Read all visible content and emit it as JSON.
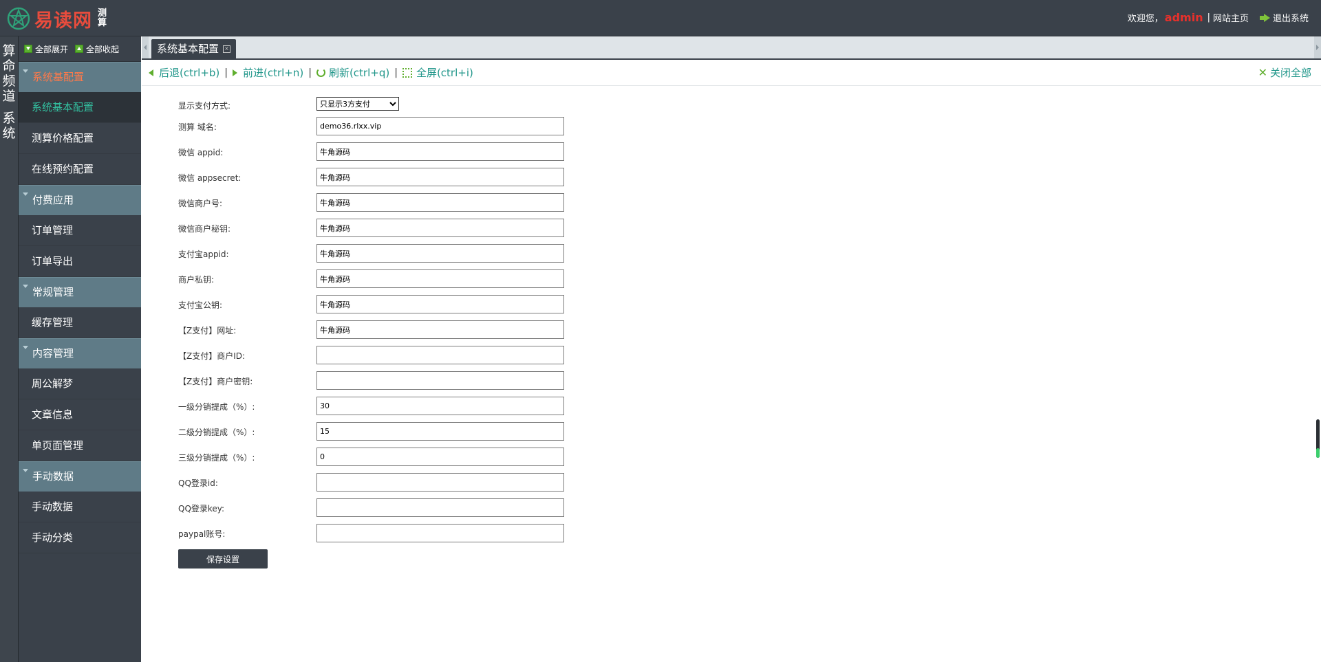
{
  "header": {
    "logo_text": "易读网",
    "logo_sub": "测算",
    "welcome": "欢迎您，",
    "username": "admin",
    "site_home": "网站主页",
    "logout": "退出系统",
    "separator": "|"
  },
  "channels": [
    {
      "label": "算命频道"
    },
    {
      "label": "系统"
    }
  ],
  "sidebar": {
    "expand_all": "全部展开",
    "collapse_all": "全部收起",
    "groups": [
      {
        "title": "系统基配置",
        "items": [
          "系统基本配置",
          "测算价格配置",
          "在线预约配置"
        ]
      },
      {
        "title": "付费应用",
        "items": [
          "订单管理",
          "订单导出"
        ]
      },
      {
        "title": "常规管理",
        "items": [
          "缓存管理"
        ]
      },
      {
        "title": "内容管理",
        "items": [
          "周公解梦",
          "文章信息",
          "单页面管理"
        ]
      },
      {
        "title": "手动数据",
        "items": [
          "手动数据",
          "手动分类"
        ]
      }
    ]
  },
  "tabs": [
    {
      "label": "系统基本配置",
      "close": "×"
    }
  ],
  "toolbar": {
    "back": "后退(ctrl+b)",
    "forward": "前进(ctrl+n)",
    "refresh": "刷新(ctrl+q)",
    "fullscreen": "全屏(ctrl+i)",
    "close_all": "关闭全部",
    "sep": "|"
  },
  "form": {
    "pay_mode": {
      "label": "显示支付方式:",
      "selected": "只显示3方支付"
    },
    "fields": [
      {
        "label": "测算 域名:",
        "value": "demo36.rlxx.vip"
      },
      {
        "label": "微信 appid:",
        "value": "牛角源码"
      },
      {
        "label": "微信 appsecret:",
        "value": "牛角源码"
      },
      {
        "label": "微信商户号:",
        "value": "牛角源码"
      },
      {
        "label": "微信商户秘钥:",
        "value": "牛角源码"
      },
      {
        "label": "支付宝appid:",
        "value": "牛角源码"
      },
      {
        "label": "商户私钥:",
        "value": "牛角源码"
      },
      {
        "label": "支付宝公钥:",
        "value": "牛角源码"
      },
      {
        "label": "【Z支付】网址:",
        "value": "牛角源码"
      },
      {
        "label": "【Z支付】商户ID:",
        "value": ""
      },
      {
        "label": "【Z支付】商户密钥:",
        "value": ""
      },
      {
        "label": "一级分销提成（%）:",
        "value": "30"
      },
      {
        "label": "二级分销提成（%）:",
        "value": "15"
      },
      {
        "label": "三级分销提成（%）:",
        "value": "0"
      },
      {
        "label": "QQ登录id:",
        "value": ""
      },
      {
        "label": "QQ登录key:",
        "value": ""
      },
      {
        "label": "paypal账号:",
        "value": ""
      }
    ],
    "save_label": "保存设置"
  },
  "colors": {
    "header_bg": "#3a414a",
    "group_bg": "#5f7b87",
    "active_item": "#33c0a0",
    "active_group": "#ff7a4a",
    "toolbar_text": "#20968a",
    "admin_red": "#e8302b"
  }
}
